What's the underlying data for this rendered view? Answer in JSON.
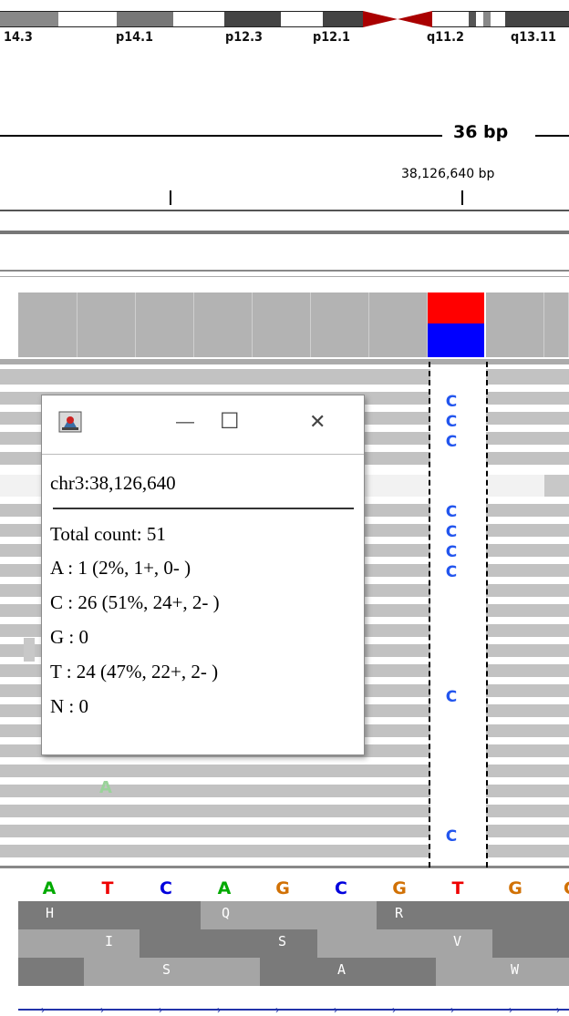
{
  "ideogram": {
    "bands": [
      "14.3",
      "p14.1",
      "p12.3",
      "p12.1",
      "q11.2",
      "q13.11"
    ]
  },
  "ruler": {
    "span": "36 bp",
    "position": "38,126,640 bp"
  },
  "coverage": {
    "highlight_column": {
      "top_color": "#ff0000",
      "bottom_color": "#0000ff"
    }
  },
  "reads": {
    "mismatch_base": "C",
    "other_base": "A"
  },
  "popup": {
    "title_icon": "java-app-icon",
    "minimize": "—",
    "maximize": "☐",
    "close": "✕",
    "locus": "chr3:38,126,640",
    "total": "Total count: 51",
    "a": "A : 1 (2%, 1+, 0- )",
    "c": "C : 26 (51%, 24+, 2- )",
    "g": "G : 0",
    "t": "T : 24 (47%, 22+, 2- )",
    "n": "N : 0"
  },
  "sequence": {
    "bases": [
      "A",
      "T",
      "C",
      "A",
      "G",
      "C",
      "G",
      "T",
      "G"
    ],
    "colors": {
      "A": "#00aa00",
      "T": "#ee0000",
      "C": "#0000dd",
      "G": "#d17105"
    }
  },
  "translation": {
    "frame1": [
      "H",
      "Q",
      "R"
    ],
    "frame2": [
      "I",
      "S",
      "V"
    ],
    "frame3": [
      "S",
      "A",
      "W"
    ]
  }
}
